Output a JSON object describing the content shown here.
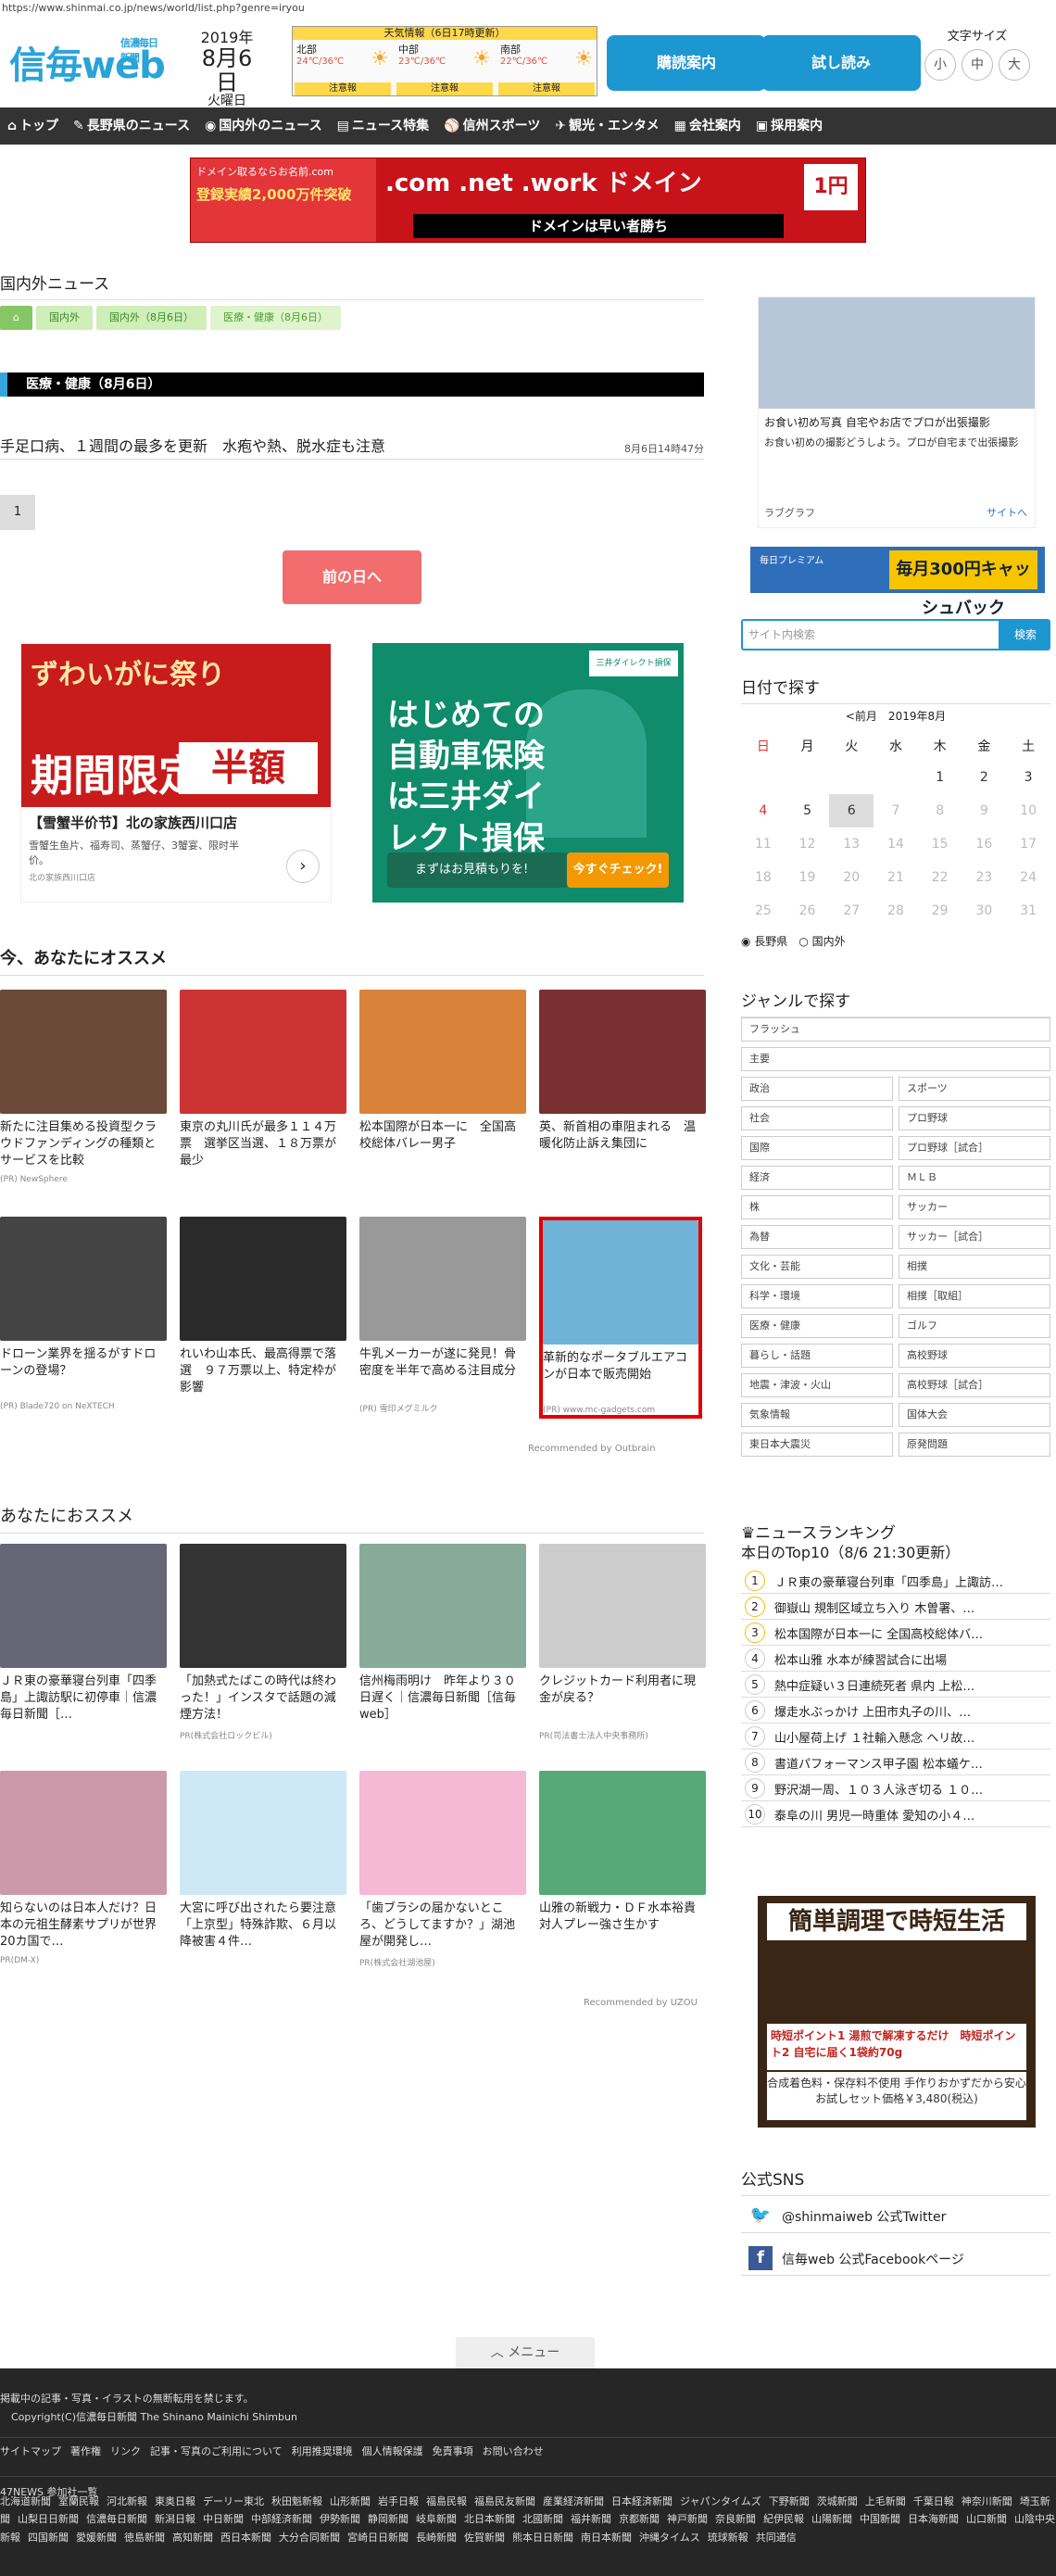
{
  "url": "https://www.shinmai.co.jp/news/world/list.php?genre=iryou",
  "header": {
    "logo": "信毎web",
    "logo_sub": "信濃毎日新聞",
    "year": "2019年",
    "monthday": "8月6日",
    "weekday": "火曜日",
    "weather_title": "天気情報（6日17時更新）",
    "weather": [
      {
        "region": "北部",
        "temp": "24℃/36℃",
        "badge": "注意報"
      },
      {
        "region": "中部",
        "temp": "23℃/36℃",
        "badge": "注意報"
      },
      {
        "region": "南部",
        "temp": "22℃/36℃",
        "badge": "注意報"
      }
    ],
    "btn_subscribe": "購読案内",
    "btn_trial": "試し読み",
    "fontsize_label": "文字サイズ",
    "fontsizes": [
      "小",
      "中",
      "大"
    ]
  },
  "nav": [
    {
      "icon": "⌂",
      "label": "トップ"
    },
    {
      "icon": "✎",
      "label": "長野県のニュース"
    },
    {
      "icon": "◉",
      "label": "国内外のニュース"
    },
    {
      "icon": "▤",
      "label": "ニュース特集"
    },
    {
      "icon": "⚾",
      "label": "信州スポーツ"
    },
    {
      "icon": "✈",
      "label": "観光・エンタメ"
    },
    {
      "icon": "▦",
      "label": "会社案内"
    },
    {
      "icon": "▣",
      "label": "採用案内"
    }
  ],
  "banner": {
    "a": "ドメイン取るならお名前.com",
    "b": "登録実績2,000万件突破",
    "c": ".com .net .work ドメイン",
    "price": "1円",
    "d": "ドメインは早い者勝ち"
  },
  "page_title": "国内外ニュース",
  "breadcrumb": [
    "⌂",
    "国内外",
    "国内外（8月6日）",
    "医療・健康（8月6日）"
  ],
  "section_bar": "医療・健康（8月6日）",
  "article": {
    "title": "手足口病、１週間の最多を更新　水疱や熱、脱水症も注意",
    "date": "8月6日14時47分"
  },
  "pager": "1",
  "prev_button": "前の日へ",
  "ad_crab": {
    "headline": "ずわいがに祭り",
    "limit": "期間限定",
    "half": "半額",
    "title": "【雪蟹半价节】北の家族西川口店",
    "sub": "雪蟹生鱼片、福寿司、蒸蟹仔、3蟹宴、限时半价。",
    "by": "北の家族西川口店"
  },
  "ad_ins": {
    "headline": "はじめての自動車保険は三井ダイレクト損保",
    "mark": "まずはお見積もりを!",
    "cta": "今すぐチェック!",
    "logo": "三井ダイレクト損保"
  },
  "rec1_title": "今、あなたにオススメ",
  "rec1": [
    {
      "title": "新たに注目集める投資型クラウドファンディングの種類とサービスを比較",
      "src": "(PR) NewSphere",
      "color": "#6b4a3a"
    },
    {
      "title": "東京の丸川氏が最多１１４万票　選挙区当選、１８万票が最少",
      "src": "",
      "color": "#c33"
    },
    {
      "title": "松本国際が日本一に　全国高校総体バレー男子",
      "src": "",
      "color": "#d9823a"
    },
    {
      "title": "英、新首相の車阻まれる　温暖化防止訴え集団に",
      "src": "",
      "color": "#7a3030"
    },
    {
      "title": "ドローン業界を揺るがすドローンの登場？",
      "src": "(PR) Blade720 on NeXTECH",
      "color": "#444"
    },
    {
      "title": "れいわ山本氏、最高得票で落選　９７万票以上、特定枠が影響",
      "src": "",
      "color": "#2a2a2a"
    },
    {
      "title": "牛乳メーカーが遂に発見！骨密度を半年で高める注目成分",
      "src": "(PR) 雪印メグミルク",
      "color": "#999"
    },
    {
      "title": "革新的なポータブルエアコンが日本で販売開始",
      "src": "(PR) www.mc-gadgets.com",
      "color": "#6fb3d9"
    }
  ],
  "outbrain": "Recommended by Outbrain",
  "rec2_title": "あなたにおススメ",
  "rec2": [
    {
      "title": "ＪＲ東の豪華寝台列車「四季島」上諏訪駅に初停車｜信濃毎日新聞［…",
      "src": "",
      "color": "#667"
    },
    {
      "title": "「加熱式たばこの時代は終わった！」インスタで話題の減煙方法！",
      "src": "PR(株式会社ロックビル)",
      "color": "#333"
    },
    {
      "title": "信州梅雨明け　昨年より３０日遅く｜信濃毎日新聞［信毎web］",
      "src": "",
      "color": "#8a9"
    },
    {
      "title": "クレジットカード利用者に現金が戻る？",
      "src": "PR(司法書士法人中央事務所)",
      "color": "#ccc"
    },
    {
      "title": "知らないのは日本人だけ？日本の元祖生酵素サプリが世界20カ国で…",
      "src": "PR(DM-X)",
      "color": "#c9a"
    },
    {
      "title": "大宮に呼び出されたら要注意　「上京型」特殊詐欺、６月以降被害４件…",
      "src": "",
      "color": "#cfe8f5"
    },
    {
      "title": "「歯ブラシの届かないところ、どうしてますか？」湖池屋が開発し…",
      "src": "PR(株式会社湖池屋)",
      "color": "#f5b9d6"
    },
    {
      "title": "山雅の新戦力・ＤＦ水本裕貴　対人プレー強さ生かす",
      "src": "",
      "color": "#5a7"
    }
  ],
  "uzou": "Recommended by UZOU",
  "side_ad": {
    "title": "お食い初め写真 自宅やお店でプロが出張撮影",
    "sub": "お食い初めの撮影どうしよう。プロが自宅まで出張撮影",
    "brand": "ラブグラフ",
    "site": "サイトへ"
  },
  "side_banner": {
    "a": "毎日プレミアム",
    "b": "毎月300円キャッシュバック"
  },
  "search": {
    "placeholder": "サイト内検索",
    "button": "検索"
  },
  "date_search": {
    "title": "日付で探す",
    "nav": "<前月　2019年8月",
    "weekdays": [
      "日",
      "月",
      "火",
      "水",
      "木",
      "金",
      "土"
    ],
    "weeks": [
      [
        "",
        "",
        "",
        "",
        "1",
        "2",
        "3"
      ],
      [
        "4",
        "5",
        "6",
        "7",
        "8",
        "9",
        "10"
      ],
      [
        "11",
        "12",
        "13",
        "14",
        "15",
        "16",
        "17"
      ],
      [
        "18",
        "19",
        "20",
        "21",
        "22",
        "23",
        "24"
      ],
      [
        "25",
        "26",
        "27",
        "28",
        "29",
        "30",
        "31"
      ]
    ],
    "radio": [
      "長野県",
      "国内外"
    ]
  },
  "genre_title": "ジャンルで探す",
  "genres": [
    "フラッシュ",
    "主要",
    "政治",
    "スポーツ",
    "社会",
    "プロ野球",
    "国際",
    "プロ野球［試合］",
    "経済",
    "ＭＬＢ",
    "株",
    "サッカー",
    "為替",
    "サッカー［試合］",
    "文化・芸能",
    "相撲",
    "科学・環境",
    "相撲［取組］",
    "医療・健康",
    "ゴルフ",
    "暮らし・話題",
    "高校野球",
    "地震・津波・火山",
    "高校野球［試合］",
    "気象情報",
    "国体大会",
    "東日本大震災",
    "原発問題"
  ],
  "ranking": {
    "title": "ニュースランキング",
    "sub": "本日のTop10（8/6 21:30更新）",
    "items": [
      "ＪＲ東の豪華寝台列車「四季島」上諏訪…",
      "御嶽山 規制区域立ち入り 木曽署、…",
      "松本国際が日本一に 全国高校総体バ…",
      "松本山雅 水本が練習試合に出場",
      "熱中症疑い３日連続死者 県内 上松…",
      "爆走水ぶっかけ 上田市丸子の川、…",
      "山小屋荷上げ １社輸入懸念 ヘリ故…",
      "書道パフォーマンス甲子園 松本蟻ケ…",
      "野沢湖一周、１０３人泳ぎ切る １０…",
      "泰阜の川 男児一時重体 愛知の小４…"
    ]
  },
  "side_ad2": {
    "a": "簡単調理で時短生活",
    "b": "時短ポイント1 湯煎で解凍するだけ　時短ポイント2 自宅に届く1袋約70g",
    "c": "合成着色料・保存料不使用 手作りおかずだから安心 お試しセット価格￥3,480(税込)"
  },
  "sns": {
    "title": "公式SNS",
    "twitter": "@shinmaiweb 公式Twitter",
    "facebook": "信毎web 公式Facebookページ"
  },
  "menu": "メニュー",
  "footer": {
    "l1": "掲載中の記事・写真・イラストの無断転用を禁じます。",
    "l2": "Copyright(C)信濃毎日新聞 The Shinano Mainichi Shimbun",
    "links": [
      "サイトマップ",
      "著作権",
      "リンク",
      "記事・写真のご利用について",
      "利用推奨環境",
      "個人情報保護",
      "免責事項",
      "お問い合わせ"
    ],
    "np": "47NEWS 参加社一覧",
    "papers": [
      "北海道新聞",
      "室蘭民報",
      "河北新報",
      "東奥日報",
      "デーリー東北",
      "秋田魁新報",
      "山形新聞",
      "岩手日報",
      "福島民報",
      "福島民友新聞",
      "産業経済新聞",
      "日本経済新聞",
      "ジャパンタイムズ",
      "下野新聞",
      "茨城新聞",
      "上毛新聞",
      "千葉日報",
      "神奈川新聞",
      "埼玉新聞",
      "山梨日日新聞",
      "信濃毎日新聞",
      "新潟日報",
      "中日新聞",
      "中部経済新聞",
      "伊勢新聞",
      "静岡新聞",
      "岐阜新聞",
      "北日本新聞",
      "北國新聞",
      "福井新聞",
      "京都新聞",
      "神戸新聞",
      "奈良新聞",
      "紀伊民報",
      "山陽新聞",
      "中国新聞",
      "日本海新聞",
      "山口新聞",
      "山陰中央新報",
      "四国新聞",
      "愛媛新聞",
      "徳島新聞",
      "高知新聞",
      "西日本新聞",
      "大分合同新聞",
      "宮崎日日新聞",
      "長崎新聞",
      "佐賀新聞",
      "熊本日日新聞",
      "南日本新聞",
      "沖縄タイムス",
      "琉球新報",
      "共同通信"
    ]
  }
}
